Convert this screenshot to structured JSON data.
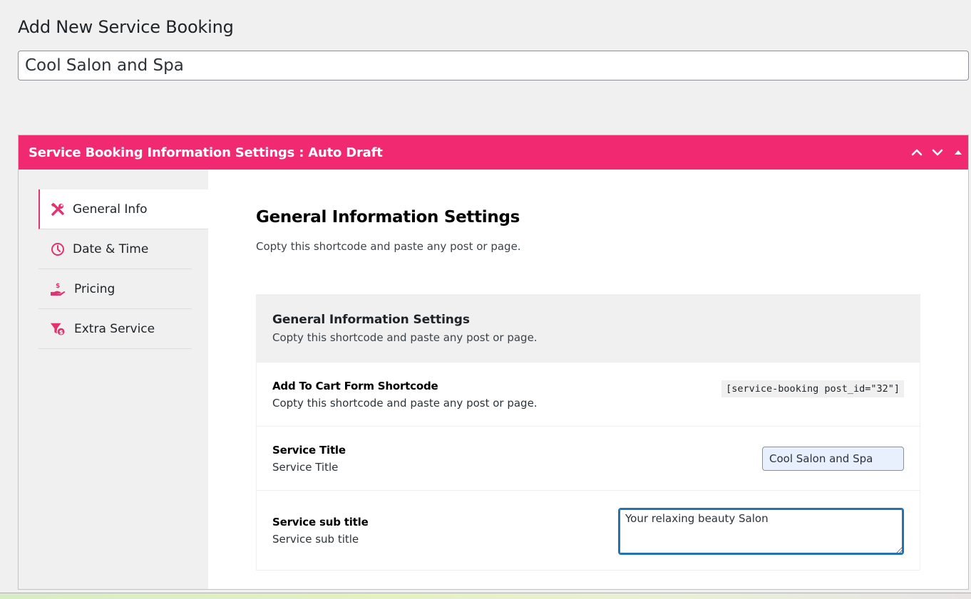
{
  "page": {
    "title": "Add New Service Booking",
    "post_title_value": "Cool Salon and Spa"
  },
  "metabox": {
    "title": "Service Booking Information Settings : Auto Draft",
    "controls": {
      "move_up": "chevron-up-icon",
      "move_down": "chevron-down-icon",
      "toggle": "triangle-up-icon"
    },
    "accent_color": "#f12971"
  },
  "sidebar": {
    "items": [
      {
        "label": "General Info",
        "icon": "tools-icon",
        "active": true
      },
      {
        "label": "Date & Time",
        "icon": "clock-icon",
        "active": false
      },
      {
        "label": "Pricing",
        "icon": "hand-dollar-icon",
        "active": false
      },
      {
        "label": "Extra Service",
        "icon": "filter-dollar-icon",
        "active": false
      }
    ]
  },
  "main": {
    "section_title": "General Information Settings",
    "section_desc": "Copty this shortcode and paste any post or page.",
    "box": {
      "title": "General Information Settings",
      "desc": "Copty this shortcode and paste any post or page.",
      "rows": [
        {
          "label": "Add To Cart Form Shortcode",
          "desc": "Copty this shortcode and paste any post or page.",
          "shortcode": "[service-booking post_id=\"32\"]"
        },
        {
          "label": "Service Title",
          "desc": "Service Title",
          "value": "Cool Salon and Spa"
        },
        {
          "label": "Service sub title",
          "desc": "Service sub title",
          "value": "Your relaxing beauty Salon"
        }
      ]
    }
  }
}
